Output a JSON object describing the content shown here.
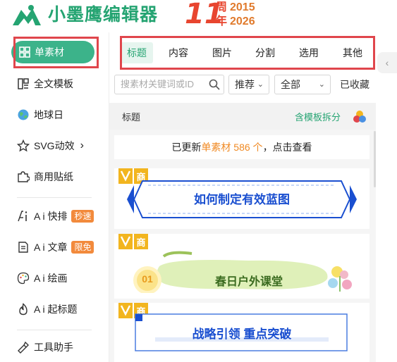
{
  "header": {
    "app_name": "小墨鹰编辑器",
    "anniversary": {
      "number": "11",
      "zhou": "周",
      "nian": "年",
      "year_start": "2015",
      "year_end": "2026"
    }
  },
  "sidebar": {
    "items": [
      {
        "label": "单素材",
        "icon": "grid-icon",
        "active": true
      },
      {
        "label": "全文模板",
        "icon": "template-icon"
      },
      {
        "label": "地球日",
        "icon": "globe-icon"
      },
      {
        "label": "SVG动效",
        "icon": "star-icon",
        "suffix": "›"
      },
      {
        "label": "商用贴纸",
        "icon": "puzzle-icon"
      },
      {
        "label": "A i 快排",
        "icon": "ai-icon",
        "badge": "秒速"
      },
      {
        "label": "A i 文章",
        "icon": "doc-icon",
        "badge": "限免"
      },
      {
        "label": "A i 绘画",
        "icon": "palette-icon"
      },
      {
        "label": "A i 起标题",
        "icon": "fire-icon"
      },
      {
        "label": "工具助手",
        "icon": "tool-icon"
      }
    ]
  },
  "tabs": [
    {
      "label": "标题",
      "active": true
    },
    {
      "label": "内容"
    },
    {
      "label": "图片"
    },
    {
      "label": "分割"
    },
    {
      "label": "选用"
    },
    {
      "label": "其他"
    }
  ],
  "filters": {
    "search_placeholder": "搜素材关键词或ID",
    "sort": "推荐",
    "scope": "全部",
    "favorites": "已收藏"
  },
  "section": {
    "title": "标题",
    "split_link": "含模板拆分"
  },
  "notice": {
    "prefix": "已更新",
    "highlight": "单素材 586 个",
    "suffix": "，点击查看"
  },
  "cards": [
    {
      "vip_label": "商",
      "text": "如何制定有效蓝图"
    },
    {
      "vip_label": "商",
      "number": "01",
      "text": "春日户外课堂"
    },
    {
      "vip_label": "商",
      "text": "战略引领 重点突破"
    }
  ],
  "colors": {
    "brand_green": "#25a472",
    "active_green": "#3cb38a",
    "anniv_red": "#e8452f",
    "highlight_red_box": "#e0464c",
    "vip_gold": "#f2b51f",
    "banner_blue": "#1a4fd0"
  }
}
